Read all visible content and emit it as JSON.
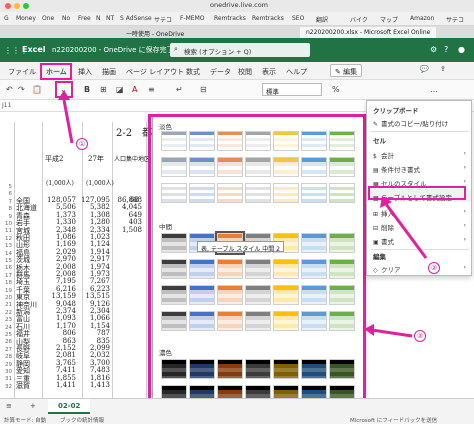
{
  "browser": {
    "url": "onedrive.live.com",
    "bookmarks": [
      "G",
      "Money",
      "One",
      "No",
      "Free",
      "N",
      "NT",
      "S AdSense",
      "サテコ",
      "F-MEMO",
      "Remtracks",
      "Remtracks",
      "SEO",
      "翻訳",
      "バイク",
      "マップ",
      "Amazon",
      "サテコ"
    ],
    "tabs": [
      "一時使用 - OneDrive",
      "n220200200.xlsx - Microsoft Excel Online"
    ]
  },
  "excel": {
    "app_name": "Excel",
    "doc_title": "n220200200 - OneDrive に保存完了",
    "search_placeholder": "検索 (オプション + Q)",
    "ribbon_tabs": [
      "ファイル",
      "ホーム",
      "挿入",
      "描画",
      "ページ レイアウト",
      "数式",
      "データ",
      "校閲",
      "表示",
      "ヘルプ"
    ],
    "edit_label": "編集",
    "font_name": "標準",
    "namebox": "J11"
  },
  "sheet": {
    "title": "2-2　都道",
    "header_cells": [
      "平成2",
      "27年",
      "人口集中地区"
    ],
    "unit_cells": [
      "(1,000人)",
      "(1,000人)"
    ],
    "row_numbers": [
      "5",
      "6",
      "7",
      "8",
      "9",
      "10",
      "11",
      "12",
      "13",
      "14",
      "15",
      "16",
      "17",
      "18",
      "19",
      "20",
      "21",
      "22",
      "23",
      "24",
      "25",
      "26",
      "27",
      "28",
      "29",
      "30",
      "31",
      "32"
    ],
    "prefectures": [
      "全国",
      "北海道",
      "青森",
      "岩手",
      "宮城",
      "秋田",
      "山形",
      "福島",
      "茨城",
      "栃木",
      "群馬",
      "埼玉",
      "千葉",
      "東京",
      "神奈川",
      "新潟",
      "富山",
      "石川",
      "福井",
      "山梨",
      "長野",
      "岐阜",
      "静岡",
      "愛知",
      "三重",
      "滋賀"
    ],
    "col1": [
      "128,057",
      "5,506",
      "1,373",
      "1,330",
      "2,348",
      "1,086",
      "1,169",
      "2,029",
      "2,970",
      "2,008",
      "2,008",
      "7,195",
      "6,216",
      "13,159",
      "9,048",
      "2,374",
      "1,093",
      "1,170",
      "806",
      "863",
      "2,152",
      "2,081",
      "3,765",
      "7,411",
      "1,855",
      "1,411"
    ],
    "col2": [
      "127,095",
      "5,382",
      "1,308",
      "1,280",
      "2,334",
      "1,023",
      "1,124",
      "1,914",
      "2,917",
      "1,974",
      "1,973",
      "7,267",
      "6,223",
      "13,515",
      "9,126",
      "2,304",
      "1,066",
      "1,154",
      "787",
      "835",
      "2,099",
      "2,032",
      "3,700",
      "7,483",
      "1,816",
      "1,413"
    ],
    "col3": [
      "86,868",
      "4,045",
      "649",
      "403",
      "1,508",
      ""
    ],
    "col4": [
      "68"
    ]
  },
  "gallery": {
    "sections": [
      "淡色",
      "中間",
      "濃色"
    ],
    "tooltip": "表, テーブル スタイル 中間 2"
  },
  "menu": {
    "sections": [
      "クリップボード",
      "セル",
      "編集"
    ],
    "items": [
      {
        "label": "書式のコピー/貼り付け",
        "icon": "brush-icon"
      },
      {
        "label": "会計",
        "icon": "accounting-icon"
      },
      {
        "label": "条件付き書式",
        "icon": "conditional-format-icon"
      },
      {
        "label": "セルのスタイル",
        "icon": "cell-style-icon"
      },
      {
        "label": "テーブルとして書式設定",
        "icon": "table-format-icon"
      },
      {
        "label": "挿入",
        "icon": "insert-icon"
      },
      {
        "label": "削除",
        "icon": "delete-icon"
      },
      {
        "label": "書式",
        "icon": "format-icon"
      },
      {
        "label": "クリア",
        "icon": "clear-icon"
      }
    ]
  },
  "annotations": [
    "①",
    "②",
    "③"
  ],
  "bottom": {
    "sheet_tab": "02-02",
    "status_left": "計算モード: 自動",
    "status_left2": "ブックの統計情報",
    "status_right": "Microsoft にフィードバックを送信"
  },
  "colors": {
    "excel_green": "#217346",
    "annotation_pink": "#e0209f"
  }
}
